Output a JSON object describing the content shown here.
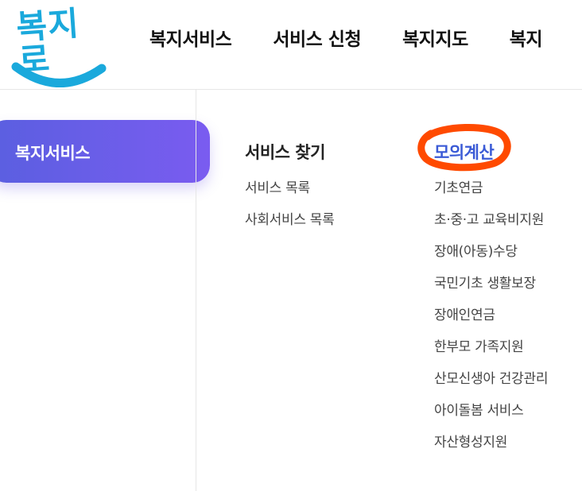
{
  "brand": {
    "logo_text": "복지로",
    "logo_color": "#1aa9dc"
  },
  "nav": {
    "items": [
      {
        "label": "복지서비스"
      },
      {
        "label": "서비스 신청"
      },
      {
        "label": "복지지도"
      },
      {
        "label": "복지"
      }
    ]
  },
  "sidebar": {
    "active_label": "복지서비스",
    "gradient_start": "#5a5fe0",
    "gradient_end": "#7a5cf0"
  },
  "menu": {
    "columns": [
      {
        "title": "서비스 찾기",
        "items": [
          "서비스 목록",
          "사회서비스 목록"
        ]
      },
      {
        "title": "모의계산",
        "highlighted": true,
        "annotation_color": "#ff4a00",
        "items": [
          "기초연금",
          "초·중·고 교육비지원",
          "장애(아동)수당",
          "국민기초 생활보장",
          "장애인연금",
          "한부모 가족지원",
          "산모신생아 건강관리",
          "아이돌봄 서비스",
          "자산형성지원"
        ]
      }
    ]
  }
}
